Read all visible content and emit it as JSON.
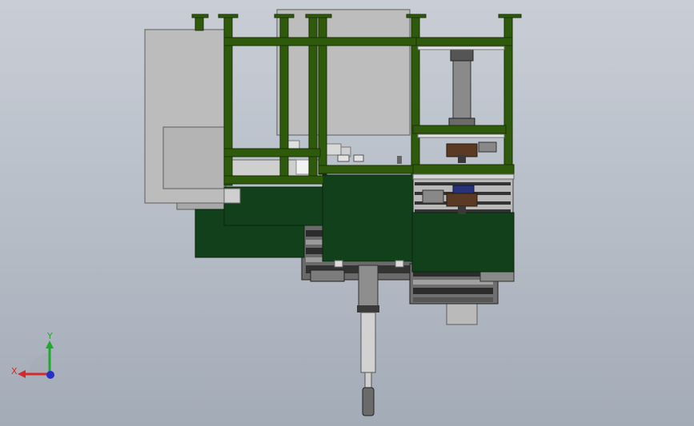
{
  "viewport": {
    "colors": {
      "frame": "#2f5a0c",
      "frame_edge": "#1a3306",
      "panel_dark": "#12401a",
      "panel_edge": "#0a2410",
      "sheet_grey": "#bcbcbc",
      "sheet_edge": "#5e5e5e",
      "cylinder": "#8e8e8e",
      "brown_block": "#5a3a22",
      "blue_part": "#27327a",
      "mech_dark": "#3a3a3a"
    }
  },
  "triad": {
    "x_label": "X",
    "y_label": "Y",
    "x_color": "#d42a2a",
    "y_color": "#1eaa2a",
    "z_color": "#2430c8"
  }
}
